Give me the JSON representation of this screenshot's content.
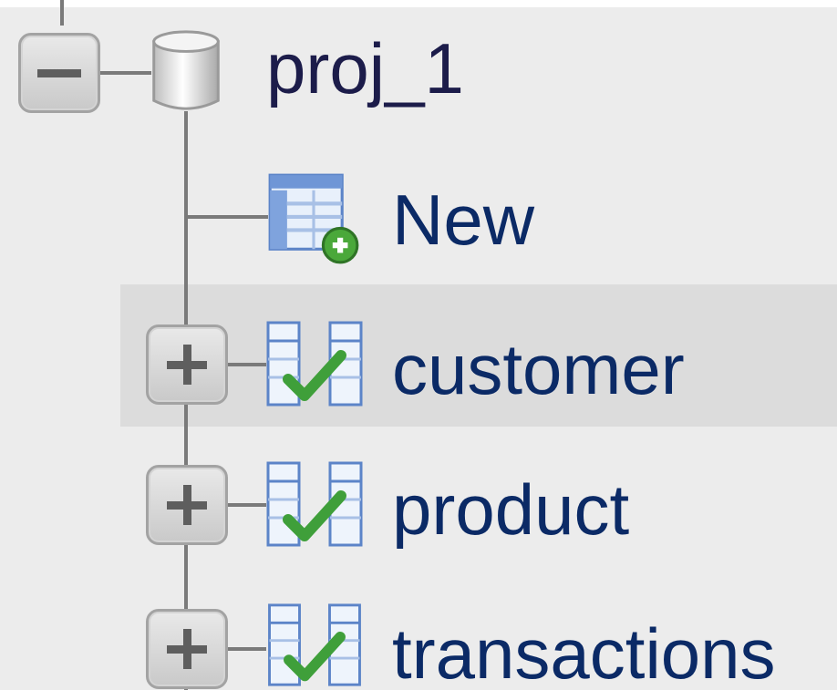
{
  "tree": {
    "database": {
      "name": "proj_1",
      "expanded": true,
      "icon": "database-icon"
    },
    "new_table": {
      "label": "New",
      "icon": "new-table-icon"
    },
    "tables": [
      {
        "name": "customer",
        "expanded": false,
        "icon": "table-icon",
        "hovered": true
      },
      {
        "name": "product",
        "expanded": false,
        "icon": "table-icon",
        "hovered": false
      },
      {
        "name": "transactions",
        "expanded": false,
        "icon": "table-icon",
        "hovered": false
      }
    ]
  },
  "colors": {
    "panel_background": "#ececec",
    "hover_background": "#dcdcdc",
    "tree_line": "#7a7a7a",
    "label_text": "#0b2a66",
    "toggle_border": "#a3a3a3",
    "check_green": "#3f9f3a"
  }
}
